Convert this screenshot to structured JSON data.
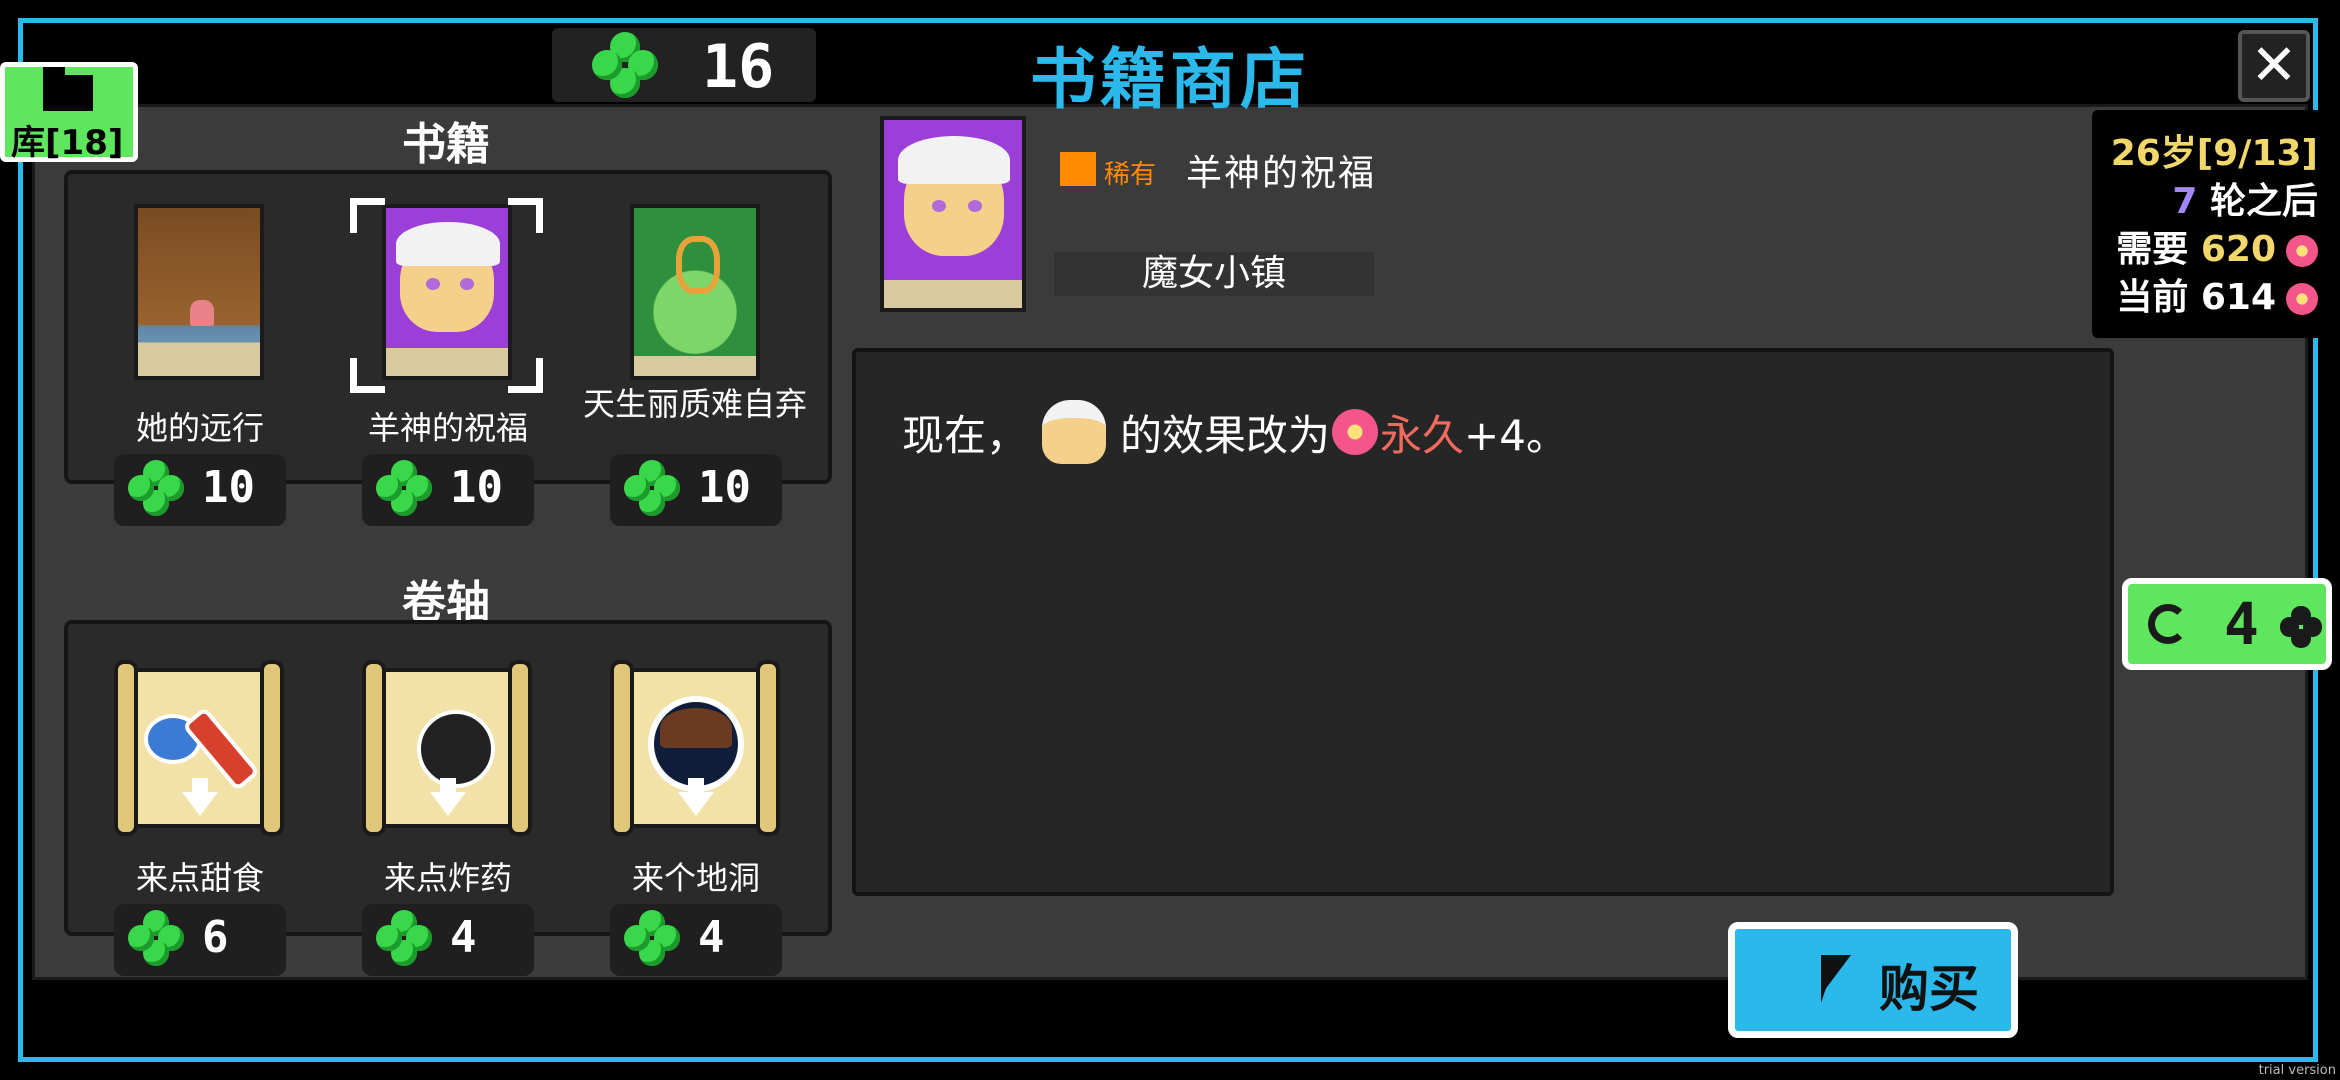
{
  "header": {
    "currency_icon": "clover-icon",
    "currency_value": "16",
    "title": "书籍商店",
    "close_icon": "close-icon",
    "library_label": "库[18]"
  },
  "books": {
    "section_title": "书籍",
    "items": [
      {
        "name": "她的远行",
        "price": "10"
      },
      {
        "name": "羊神的祝福",
        "price": "10"
      },
      {
        "name": "天生丽质难自弃",
        "price": "10"
      }
    ]
  },
  "scrolls": {
    "section_title": "卷轴",
    "items": [
      {
        "name": "来点甜食",
        "price": "6"
      },
      {
        "name": "来点炸药",
        "price": "4"
      },
      {
        "name": "来个地洞",
        "price": "4"
      }
    ]
  },
  "detail": {
    "rarity": "稀有",
    "name": "羊神的祝福",
    "set": "魔女小镇",
    "desc_prefix": "现在，",
    "desc_middle": "的效果改为",
    "desc_keyword": "永久",
    "desc_suffix": "+4。"
  },
  "stats": {
    "age_num": "26",
    "age_rest": "岁[9/13]",
    "rounds_num": "7",
    "rounds_rest": " 轮之后",
    "need_label": "需要 ",
    "need_value": "620",
    "current_label": "当前 614"
  },
  "refresh": {
    "value": "4"
  },
  "buy": {
    "label": "购买"
  },
  "watermark": "trial version",
  "colors": {
    "accent": "#2bb8ea",
    "clover_green": "#39d84a",
    "rarity_orange": "#ff8a00",
    "permanent_red": "#f26a5e",
    "age_yellow": "#f2d86a"
  }
}
